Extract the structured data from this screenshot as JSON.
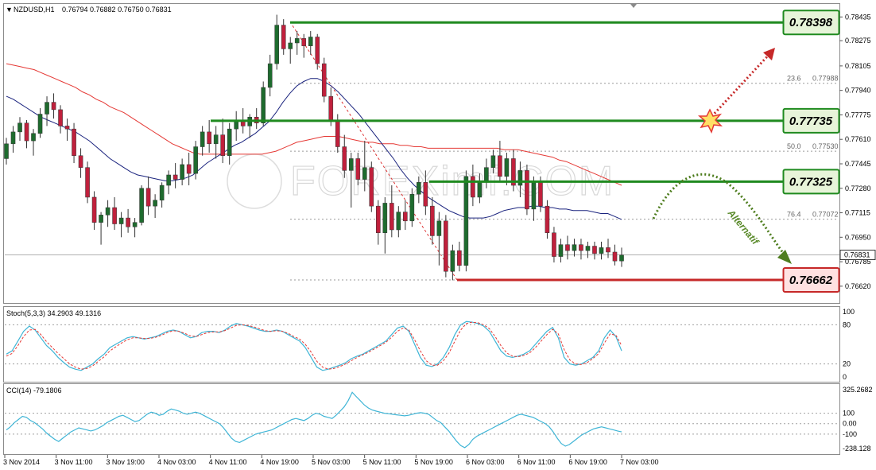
{
  "header": {
    "symbol": "NZDUSD,H1",
    "ohlc": "0.76794 0.76882 0.76750 0.76831",
    "stoch": "Stoch(5,3,3) 34.2903 49.1316",
    "cci": "CCI(14) -79.1806",
    "watermark": "FOREXimf.COM",
    "alternatif": "Alternatif"
  },
  "colors": {
    "bull": "#1e6b2e",
    "bear": "#c0203c",
    "ma_fast": "#1a237e",
    "ma_slow": "#e53935",
    "level_green": "#1f8a1f",
    "level_red": "#c62828",
    "box_green_fill": "#e7f4d9",
    "box_red_fill": "#ffe1e1",
    "osc_main": "#3fb5d6",
    "osc_signal": "#e53935"
  },
  "price_axis": {
    "ticks": [
      "0.78435",
      "0.78275",
      "0.78105",
      "0.77940",
      "0.77775",
      "0.77610",
      "0.77445",
      "0.77280",
      "0.77115",
      "0.76950",
      "0.76785",
      "0.76620"
    ],
    "current": "0.76831"
  },
  "stoch_axis": {
    "ticks": [
      "100",
      "80",
      "20",
      "0"
    ]
  },
  "cci_axis": {
    "ticks": [
      "325.2682",
      "100",
      "0.00",
      "-100",
      "-238.128"
    ]
  },
  "time_axis": [
    "3 Nov 2014",
    "3 Nov 11:00",
    "3 Nov 19:00",
    "4 Nov 03:00",
    "4 Nov 11:00",
    "4 Nov 19:00",
    "5 Nov 03:00",
    "5 Nov 11:00",
    "5 Nov 19:00",
    "6 Nov 03:00",
    "6 Nov 11:00",
    "6 Nov 19:00",
    "7 Nov 03:00"
  ],
  "levels": [
    {
      "label": "0.78398",
      "value": 0.78398,
      "kind": "green"
    },
    {
      "label": "0.77735",
      "value": 0.77735,
      "kind": "green"
    },
    {
      "label": "0.77325",
      "value": 0.77325,
      "kind": "green"
    },
    {
      "label": "0.76662",
      "value": 0.76662,
      "kind": "red"
    }
  ],
  "fibo": [
    {
      "ratio": "23.6",
      "price": "0.77988",
      "value": 0.77988
    },
    {
      "ratio": "50.0",
      "price": "0.77530",
      "value": 0.7753
    },
    {
      "ratio": "76.4",
      "price": "0.77072",
      "value": 0.77072
    }
  ],
  "chart_data": {
    "type": "candlestick",
    "title": "NZDUSD,H1",
    "ylim": [
      0.76555,
      0.78485
    ],
    "candles": [
      [
        0.7748,
        0.7762,
        0.7744,
        0.7758
      ],
      [
        0.7758,
        0.777,
        0.7752,
        0.7766
      ],
      [
        0.7766,
        0.7776,
        0.776,
        0.7772
      ],
      [
        0.7772,
        0.7774,
        0.7755,
        0.776
      ],
      [
        0.776,
        0.7768,
        0.775,
        0.7765
      ],
      [
        0.7765,
        0.7782,
        0.7762,
        0.7778
      ],
      [
        0.7778,
        0.779,
        0.777,
        0.7786
      ],
      [
        0.7786,
        0.7792,
        0.7775,
        0.7781
      ],
      [
        0.7781,
        0.7784,
        0.7765,
        0.777
      ],
      [
        0.777,
        0.7775,
        0.776,
        0.7768
      ],
      [
        0.7768,
        0.7772,
        0.7745,
        0.775
      ],
      [
        0.775,
        0.7755,
        0.7735,
        0.7742
      ],
      [
        0.7742,
        0.7746,
        0.7718,
        0.7722
      ],
      [
        0.7722,
        0.7726,
        0.77,
        0.7705
      ],
      [
        0.7705,
        0.7712,
        0.769,
        0.771
      ],
      [
        0.771,
        0.772,
        0.7702,
        0.7715
      ],
      [
        0.7715,
        0.7722,
        0.77,
        0.7704
      ],
      [
        0.7704,
        0.7712,
        0.7695,
        0.7708
      ],
      [
        0.7708,
        0.7714,
        0.7698,
        0.7702
      ],
      [
        0.7702,
        0.7708,
        0.7695,
        0.7705
      ],
      [
        0.7705,
        0.773,
        0.7703,
        0.7728
      ],
      [
        0.7728,
        0.7736,
        0.771,
        0.7716
      ],
      [
        0.7716,
        0.7724,
        0.7708,
        0.772
      ],
      [
        0.772,
        0.7732,
        0.7715,
        0.773
      ],
      [
        0.773,
        0.774,
        0.7724,
        0.7737
      ],
      [
        0.7737,
        0.7745,
        0.7728,
        0.7734
      ],
      [
        0.7734,
        0.7748,
        0.773,
        0.7744
      ],
      [
        0.7744,
        0.7752,
        0.773,
        0.7738
      ],
      [
        0.7738,
        0.776,
        0.7734,
        0.7756
      ],
      [
        0.7756,
        0.777,
        0.775,
        0.7766
      ],
      [
        0.7766,
        0.7774,
        0.7752,
        0.7758
      ],
      [
        0.7758,
        0.777,
        0.7748,
        0.7764
      ],
      [
        0.7764,
        0.7775,
        0.7745,
        0.775
      ],
      [
        0.775,
        0.7772,
        0.7744,
        0.7768
      ],
      [
        0.7768,
        0.778,
        0.776,
        0.7774
      ],
      [
        0.7774,
        0.7782,
        0.7765,
        0.777
      ],
      [
        0.777,
        0.7778,
        0.7762,
        0.7776
      ],
      [
        0.7776,
        0.7782,
        0.7768,
        0.7772
      ],
      [
        0.7772,
        0.78,
        0.777,
        0.7796
      ],
      [
        0.7796,
        0.7818,
        0.779,
        0.7812
      ],
      [
        0.7812,
        0.7845,
        0.7808,
        0.7838
      ],
      [
        0.7838,
        0.7842,
        0.7818,
        0.7822
      ],
      [
        0.7822,
        0.783,
        0.7812,
        0.7826
      ],
      [
        0.7826,
        0.7834,
        0.7818,
        0.7829
      ],
      [
        0.7829,
        0.7832,
        0.7816,
        0.7824
      ],
      [
        0.7824,
        0.7834,
        0.7818,
        0.783
      ],
      [
        0.783,
        0.7832,
        0.7808,
        0.7812
      ],
      [
        0.7812,
        0.7816,
        0.7786,
        0.779
      ],
      [
        0.779,
        0.7796,
        0.777,
        0.7774
      ],
      [
        0.7774,
        0.7778,
        0.7752,
        0.7756
      ],
      [
        0.7756,
        0.7764,
        0.7735,
        0.774
      ],
      [
        0.774,
        0.7752,
        0.7715,
        0.7748
      ],
      [
        0.7748,
        0.7752,
        0.773,
        0.7734
      ],
      [
        0.7734,
        0.776,
        0.7726,
        0.7742
      ],
      [
        0.7742,
        0.7746,
        0.7712,
        0.7716
      ],
      [
        0.7716,
        0.772,
        0.769,
        0.7698
      ],
      [
        0.7698,
        0.7722,
        0.7684,
        0.7718
      ],
      [
        0.7718,
        0.773,
        0.7695,
        0.77
      ],
      [
        0.77,
        0.7716,
        0.7695,
        0.7712
      ],
      [
        0.7712,
        0.772,
        0.77,
        0.7706
      ],
      [
        0.7706,
        0.7728,
        0.7702,
        0.7724
      ],
      [
        0.7724,
        0.7736,
        0.7718,
        0.7732
      ],
      [
        0.7732,
        0.774,
        0.771,
        0.7716
      ],
      [
        0.7716,
        0.7722,
        0.769,
        0.7696
      ],
      [
        0.7696,
        0.7712,
        0.7676,
        0.7706
      ],
      [
        0.7706,
        0.771,
        0.7668,
        0.7672
      ],
      [
        0.7672,
        0.769,
        0.7666,
        0.7686
      ],
      [
        0.7686,
        0.7692,
        0.7672,
        0.7676
      ],
      [
        0.7676,
        0.774,
        0.7672,
        0.7736
      ],
      [
        0.7736,
        0.7744,
        0.7716,
        0.7722
      ],
      [
        0.7722,
        0.7738,
        0.7718,
        0.7732
      ],
      [
        0.7732,
        0.7748,
        0.7728,
        0.7742
      ],
      [
        0.7742,
        0.7754,
        0.7738,
        0.775
      ],
      [
        0.775,
        0.776,
        0.7732,
        0.7736
      ],
      [
        0.7736,
        0.7752,
        0.773,
        0.7748
      ],
      [
        0.7748,
        0.7754,
        0.7726,
        0.773
      ],
      [
        0.773,
        0.7746,
        0.7722,
        0.774
      ],
      [
        0.774,
        0.7744,
        0.771,
        0.7714
      ],
      [
        0.7714,
        0.7736,
        0.7706,
        0.7732
      ],
      [
        0.7732,
        0.7736,
        0.7712,
        0.7716
      ],
      [
        0.7716,
        0.772,
        0.7694,
        0.7698
      ],
      [
        0.7698,
        0.7702,
        0.7678,
        0.7682
      ],
      [
        0.7682,
        0.7694,
        0.7678,
        0.769
      ],
      [
        0.769,
        0.7696,
        0.768,
        0.7686
      ],
      [
        0.7686,
        0.7694,
        0.7682,
        0.769
      ],
      [
        0.769,
        0.7694,
        0.768,
        0.7686
      ],
      [
        0.7686,
        0.7692,
        0.7681,
        0.7689
      ],
      [
        0.7689,
        0.7692,
        0.768,
        0.7684
      ],
      [
        0.7684,
        0.7692,
        0.768,
        0.7688
      ],
      [
        0.7688,
        0.7694,
        0.7681,
        0.7685
      ],
      [
        0.7685,
        0.769,
        0.7676,
        0.7679
      ],
      [
        0.7679,
        0.7688,
        0.7675,
        0.7683
      ]
    ],
    "ma_fast": [
      0.779,
      0.7788,
      0.7785,
      0.7782,
      0.7779,
      0.7776,
      0.7774,
      0.7772,
      0.777,
      0.7768,
      0.7766,
      0.7763,
      0.776,
      0.7756,
      0.7752,
      0.7748,
      0.7745,
      0.7742,
      0.7739,
      0.7737,
      0.7736,
      0.7735,
      0.7734,
      0.7733,
      0.7733,
      0.7734,
      0.7735,
      0.7737,
      0.7741,
      0.7745,
      0.7748,
      0.7751,
      0.7754,
      0.7757,
      0.7759,
      0.7762,
      0.7765,
      0.7769,
      0.7773,
      0.7779,
      0.7786,
      0.7792,
      0.7797,
      0.78,
      0.7802,
      0.7802,
      0.78,
      0.7797,
      0.7793,
      0.7788,
      0.7783,
      0.7778,
      0.7772,
      0.7766,
      0.776,
      0.7754,
      0.7748,
      0.7741,
      0.7735,
      0.773,
      0.7726,
      0.7722,
      0.7719,
      0.7716,
      0.7713,
      0.7711,
      0.7709,
      0.7708,
      0.7708,
      0.7708,
      0.7709,
      0.7711,
      0.7713,
      0.7714,
      0.7715,
      0.7715,
      0.7716,
      0.7716,
      0.7715,
      0.7715,
      0.7714,
      0.7714,
      0.7713,
      0.7713,
      0.7713,
      0.7712,
      0.7711,
      0.7711,
      0.7709,
      0.7707
    ],
    "ma_slow": [
      0.7812,
      0.7811,
      0.781,
      0.7809,
      0.7808,
      0.7806,
      0.7804,
      0.7802,
      0.78,
      0.7798,
      0.7796,
      0.7793,
      0.7791,
      0.7788,
      0.7786,
      0.7783,
      0.7781,
      0.7779,
      0.7776,
      0.7773,
      0.777,
      0.7767,
      0.7764,
      0.7761,
      0.7758,
      0.7756,
      0.7754,
      0.7752,
      0.7751,
      0.7751,
      0.7751,
      0.7751,
      0.7751,
      0.7751,
      0.7751,
      0.7751,
      0.7751,
      0.7751,
      0.7752,
      0.7753,
      0.7755,
      0.7757,
      0.7759,
      0.776,
      0.7761,
      0.7762,
      0.7763,
      0.7763,
      0.7763,
      0.7762,
      0.7761,
      0.776,
      0.7759,
      0.7759,
      0.7758,
      0.7758,
      0.7758,
      0.7757,
      0.7757,
      0.7756,
      0.7756,
      0.7755,
      0.7755,
      0.7755,
      0.7755,
      0.7755,
      0.7755,
      0.7755,
      0.7755,
      0.7755,
      0.7755,
      0.7755,
      0.7754,
      0.7754,
      0.7754,
      0.7753,
      0.7752,
      0.7751,
      0.775,
      0.7749,
      0.7747,
      0.7746,
      0.7744,
      0.7742,
      0.774,
      0.7738,
      0.7736,
      0.7734,
      0.7732,
      0.773
    ],
    "stoch_range": [
      0,
      100
    ],
    "stoch_main": [
      35,
      40,
      55,
      70,
      78,
      72,
      60,
      48,
      40,
      30,
      22,
      15,
      12,
      10,
      15,
      20,
      28,
      35,
      45,
      50,
      55,
      60,
      62,
      60,
      58,
      60,
      62,
      66,
      70,
      72,
      70,
      65,
      60,
      62,
      68,
      70,
      70,
      68,
      72,
      78,
      82,
      80,
      78,
      75,
      72,
      70,
      70,
      72,
      70,
      65,
      60,
      55,
      45,
      30,
      15,
      10,
      12,
      15,
      18,
      22,
      28,
      32,
      35,
      40,
      45,
      50,
      55,
      65,
      75,
      78,
      70,
      50,
      30,
      18,
      16,
      20,
      30,
      45,
      65,
      80,
      85,
      84,
      82,
      78,
      70,
      55,
      40,
      32,
      30,
      32,
      35,
      40,
      50,
      60,
      70,
      76,
      60,
      30,
      20,
      18,
      20,
      25,
      30,
      40,
      60,
      72,
      62,
      40
    ],
    "stoch_signal": [
      32,
      36,
      48,
      62,
      72,
      73,
      65,
      54,
      45,
      36,
      28,
      20,
      15,
      12,
      13,
      17,
      24,
      31,
      40,
      46,
      52,
      57,
      60,
      60,
      59,
      59,
      61,
      64,
      68,
      71,
      70,
      67,
      63,
      62,
      65,
      68,
      69,
      69,
      71,
      75,
      79,
      80,
      79,
      77,
      74,
      71,
      70,
      71,
      70,
      67,
      62,
      58,
      50,
      38,
      24,
      15,
      12,
      13,
      16,
      20,
      25,
      30,
      34,
      38,
      43,
      48,
      53,
      61,
      70,
      75,
      72,
      57,
      40,
      25,
      18,
      18,
      25,
      37,
      55,
      72,
      82,
      84,
      83,
      80,
      74,
      62,
      48,
      37,
      32,
      31,
      33,
      37,
      45,
      55,
      65,
      73,
      66,
      42,
      26,
      20,
      19,
      22,
      28,
      36,
      52,
      66,
      64,
      48
    ],
    "cci_range": [
      -238.128,
      325.2682
    ],
    "cci": [
      -60,
      -30,
      10,
      40,
      70,
      60,
      30,
      10,
      -20,
      -50,
      -90,
      -120,
      -150,
      -170,
      -140,
      -110,
      -80,
      -60,
      -40,
      -50,
      -60,
      -70,
      -60,
      -40,
      -20,
      10,
      30,
      50,
      70,
      80,
      60,
      40,
      20,
      30,
      60,
      90,
      110,
      100,
      80,
      90,
      120,
      140,
      130,
      120,
      100,
      90,
      100,
      110,
      100,
      80,
      60,
      40,
      20,
      0,
      -40,
      -90,
      -140,
      -170,
      -180,
      -160,
      -140,
      -120,
      -100,
      -90,
      -80,
      -70,
      -60,
      -40,
      -20,
      0,
      20,
      40,
      50,
      40,
      30,
      50,
      80,
      100,
      90,
      70,
      60,
      50,
      80,
      120,
      160,
      220,
      300,
      260,
      220,
      180,
      150,
      130,
      120,
      110,
      100,
      95,
      90,
      85,
      80,
      75,
      80,
      90,
      100,
      105,
      100,
      90,
      60,
      30,
      10,
      -30,
      -70,
      -120,
      -170,
      -210,
      -230,
      -200,
      -150,
      -120,
      -100,
      -80,
      -60,
      -40,
      -20,
      0,
      20,
      40,
      60,
      80,
      90,
      80,
      70,
      60,
      40,
      20,
      0,
      -30,
      -80,
      -140,
      -190,
      -215,
      -200,
      -170,
      -140,
      -110,
      -90,
      -70,
      -50,
      -40,
      -30,
      -40,
      -50,
      -60,
      -70,
      -79
    ]
  }
}
